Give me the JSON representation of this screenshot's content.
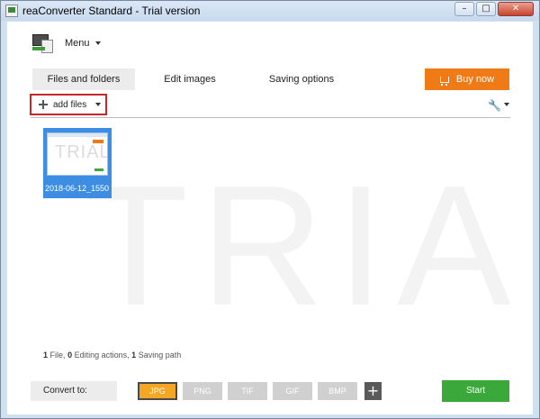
{
  "window": {
    "title": "reaConverter Standard - Trial version",
    "controls": {
      "minimize": "–",
      "maximize": "□",
      "close": "✕"
    }
  },
  "menu": {
    "label": "Menu",
    "icon": "app-logo-icon"
  },
  "watermark": "TRIAL",
  "tabs": [
    {
      "label": "Files and folders",
      "active": true
    },
    {
      "label": "Edit images",
      "active": false
    },
    {
      "label": "Saving options",
      "active": false
    }
  ],
  "buy_button": {
    "label": "Buy now",
    "icon": "cart-icon",
    "color": "#f07a16"
  },
  "toolbar": {
    "add_files_label": "add files",
    "highlight_color": "#c62828",
    "settings_icon": "wrench-icon"
  },
  "files": [
    {
      "name": "2018-06-12_1550...",
      "thumbnail_text": "TRIAL",
      "selected": true
    }
  ],
  "status": {
    "file_count": "1",
    "file_label": "File,",
    "edit_count": "0",
    "edit_label": "Editing actions,",
    "save_count": "1",
    "save_label": "Saving path"
  },
  "convert": {
    "label": "Convert to:",
    "formats": [
      {
        "label": "JPG",
        "selected": true
      },
      {
        "label": "PNG",
        "selected": false
      },
      {
        "label": "TIF",
        "selected": false
      },
      {
        "label": "GIF",
        "selected": false
      },
      {
        "label": "BMP",
        "selected": false
      }
    ],
    "add_format": "+",
    "selected_color": "#f5a623"
  },
  "start_button": {
    "label": "Start",
    "color": "#3aa83a"
  }
}
